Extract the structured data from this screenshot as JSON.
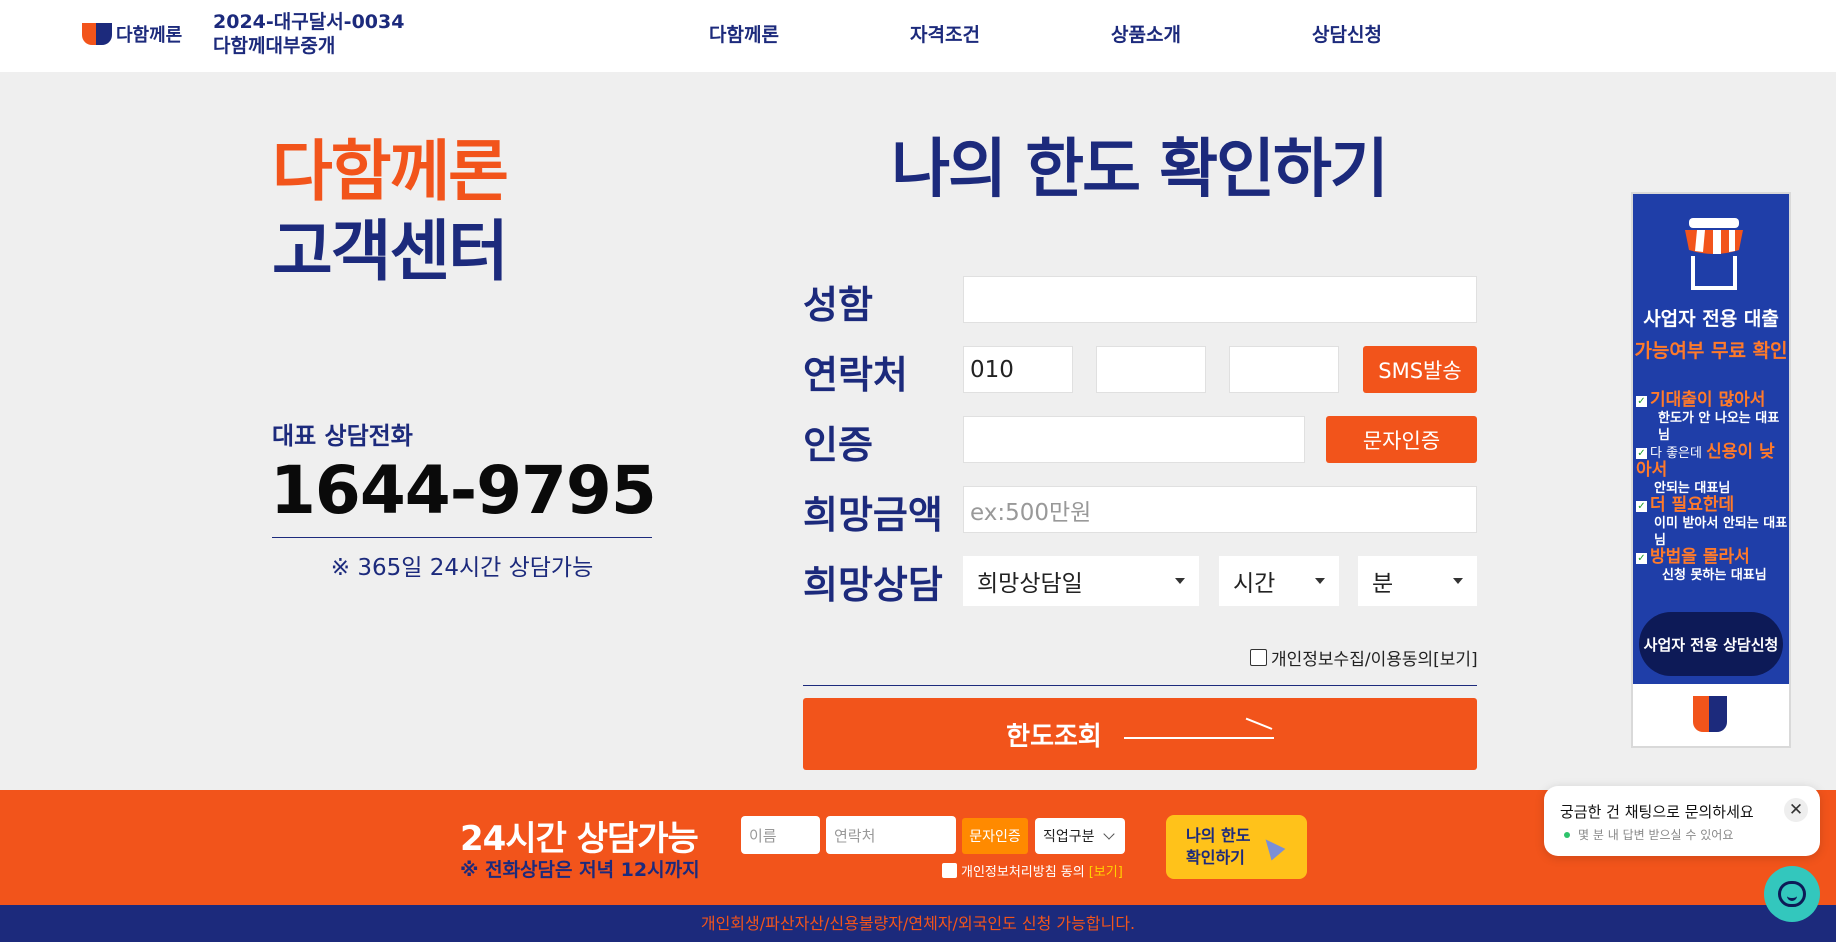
{
  "header": {
    "logo_text": "다함께론",
    "reg_line1": "2024-대구달서-0034",
    "reg_line2": "다함께대부중개",
    "nav": [
      "다함께론",
      "자격조건",
      "상품소개",
      "상담신청"
    ]
  },
  "left": {
    "brand_title": "다함께론",
    "brand_sub": "고객센터",
    "phone_label": "대표 상담전화",
    "phone_number": "1644-9795",
    "phone_note": "※ 365일 24시간 상담가능"
  },
  "form": {
    "title": "나의 한도 확인하기",
    "labels": {
      "name": "성함",
      "contact": "연락처",
      "auth": "인증",
      "amount": "희망금액",
      "schedule": "희망상담"
    },
    "phone_prefix": "010",
    "sms_button": "SMS발송",
    "auth_button": "문자인증",
    "amount_placeholder": "ex:500만원",
    "select_date": "희망상담일",
    "select_hour": "시간",
    "select_min": "분",
    "consent": "개인정보수집/이용동의[보기]",
    "submit": "한도조회"
  },
  "banner": {
    "title1": "사업자 전용 대출",
    "title2": "가능여부 무료 확인",
    "items": [
      {
        "pre": "",
        "hl": "기대출이 많아서",
        "post": "",
        "sub": "한도가 안 나오는 대표님"
      },
      {
        "pre": "다 좋은데 ",
        "hl": "신용이 낮아서",
        "post": "",
        "sub": "안되는 대표님"
      },
      {
        "pre": "",
        "hl": "더 필요한데",
        "post": "",
        "sub": "이미 받아서 안되는 대표님"
      },
      {
        "pre": "",
        "hl": "방법을 몰라서",
        "post": "",
        "sub": "신청 못하는 대표님"
      }
    ],
    "button": "사업자 전용 상담신청"
  },
  "strip": {
    "title": "24시간 상담가능",
    "subtitle": "※ 전화상담은 저녁 12시까지",
    "name_placeholder": "이름",
    "contact_placeholder": "연락처",
    "auth_button": "문자인증",
    "job_select": "직업구분",
    "consent_text": "개인정보처리방침 동의",
    "consent_view": "[보기]",
    "cta_line1": "나의 한도",
    "cta_line2": "확인하기"
  },
  "footer": {
    "text": "개인회생/파산자산/신용불량자/연체자/외국인도 신청 가능합니다."
  },
  "chat": {
    "title": "궁금한 건 채팅으로 문의하세요",
    "subtitle": "몇 분 내 답변 받으실 수 있어요",
    "close": "✕"
  },
  "colors": {
    "accent_orange": "#f2541b",
    "brand_navy": "#1c2a7c",
    "banner_blue": "#1f3ea8",
    "chat_teal": "#33c7bd"
  }
}
